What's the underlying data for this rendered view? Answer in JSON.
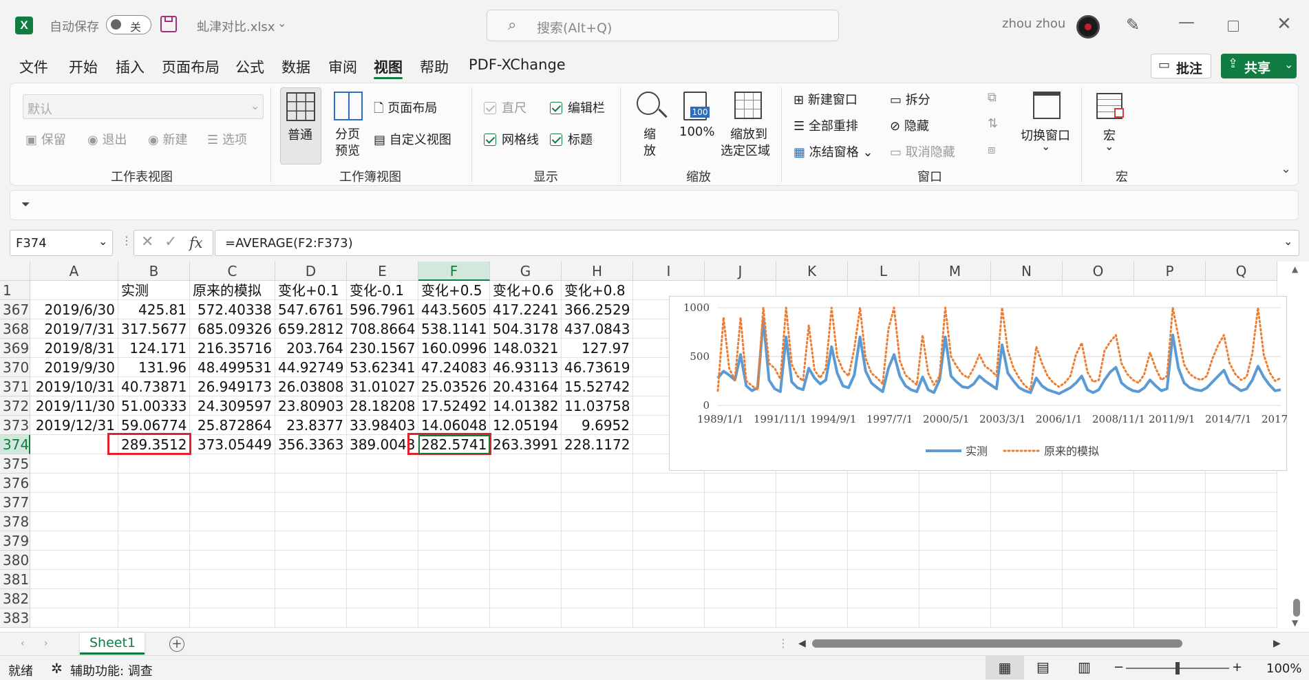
{
  "titlebar": {
    "autosave_label": "自动保存",
    "autosave_state": "关",
    "filename": "虬津对比.xlsx",
    "search_placeholder": "搜索(Alt+Q)",
    "user_name": "zhou zhou"
  },
  "menu": {
    "items": [
      "文件",
      "开始",
      "插入",
      "页面布局",
      "公式",
      "数据",
      "审阅",
      "视图",
      "帮助",
      "PDF-XChange"
    ],
    "active": "视图",
    "comments_btn": "批注",
    "share_btn": "共享"
  },
  "ribbon": {
    "sheet_view": {
      "select_value": "默认",
      "keep": "保留",
      "exit": "退出",
      "new": "新建",
      "options": "选项",
      "label": "工作表视图"
    },
    "workbook_view": {
      "normal": "普通",
      "page_break_1": "分页",
      "page_break_2": "预览",
      "page_layout": "页面布局",
      "custom_view": "自定义视图",
      "label": "工作簿视图"
    },
    "show": {
      "ruler": "直尺",
      "formula_bar": "编辑栏",
      "gridlines": "网格线",
      "headings": "标题",
      "label": "显示"
    },
    "zoom": {
      "zoom_1": "缩",
      "zoom_2": "放",
      "zoom_100": "100%",
      "zoom_sel_1": "缩放到",
      "zoom_sel_2": "选定区域",
      "label": "缩放",
      "icon_text": "100"
    },
    "window": {
      "new_window": "新建窗口",
      "arrange_all": "全部重排",
      "freeze": "冻结窗格",
      "split": "拆分",
      "hide": "隐藏",
      "unhide": "取消隐藏",
      "switch": "切换窗口",
      "label": "窗口"
    },
    "macros": {
      "macro": "宏",
      "label": "宏"
    }
  },
  "formula_bar": {
    "name_box": "F374",
    "formula": "=AVERAGE(F2:F373)",
    "fx": "fx"
  },
  "grid": {
    "columns": [
      "A",
      "B",
      "C",
      "D",
      "E",
      "F",
      "G",
      "H",
      "I",
      "J",
      "K",
      "L",
      "M",
      "N",
      "O",
      "P",
      "Q"
    ],
    "header_row": {
      "num": "1",
      "cells": [
        "",
        "实测",
        "原来的模拟",
        "变化+0.1",
        "变化-0.1",
        "变化+0.5",
        "变化+0.6",
        "变化+0.8"
      ]
    },
    "rows": [
      {
        "num": "367",
        "cells": [
          "2019/6/30",
          "425.81",
          "572.40338",
          "547.6761",
          "596.7961",
          "443.5605",
          "417.2241",
          "366.2529"
        ]
      },
      {
        "num": "368",
        "cells": [
          "2019/7/31",
          "317.5677",
          "685.09326",
          "659.2812",
          "708.8664",
          "538.1141",
          "504.3178",
          "437.0843"
        ]
      },
      {
        "num": "369",
        "cells": [
          "2019/8/31",
          "124.171",
          "216.35716",
          "203.764",
          "230.1567",
          "160.0996",
          "148.0321",
          "127.97"
        ]
      },
      {
        "num": "370",
        "cells": [
          "2019/9/30",
          "131.96",
          "48.499531",
          "44.92749",
          "53.62341",
          "47.24083",
          "46.93113",
          "46.73619"
        ]
      },
      {
        "num": "371",
        "cells": [
          "2019/10/31",
          "40.73871",
          "26.949173",
          "26.03808",
          "31.01027",
          "25.03526",
          "20.43164",
          "15.52742"
        ]
      },
      {
        "num": "372",
        "cells": [
          "2019/11/30",
          "51.00333",
          "24.309597",
          "23.80903",
          "28.18208",
          "17.52492",
          "14.01382",
          "11.03758"
        ]
      },
      {
        "num": "373",
        "cells": [
          "2019/12/31",
          "59.06774",
          "25.872864",
          "23.8377",
          "33.98403",
          "14.06048",
          "12.05194",
          "9.6952"
        ]
      },
      {
        "num": "374",
        "cells": [
          "",
          "289.3512",
          "373.05449",
          "356.3363",
          "389.0043",
          "282.5741",
          "263.3991",
          "228.1172"
        ]
      },
      {
        "num": "375",
        "cells": [
          "",
          "",
          "",
          "",
          "",
          "",
          "",
          ""
        ]
      },
      {
        "num": "376",
        "cells": [
          "",
          "",
          "",
          "",
          "",
          "",
          "",
          ""
        ]
      },
      {
        "num": "377",
        "cells": [
          "",
          "",
          "",
          "",
          "",
          "",
          "",
          ""
        ]
      },
      {
        "num": "378",
        "cells": [
          "",
          "",
          "",
          "",
          "",
          "",
          "",
          ""
        ]
      },
      {
        "num": "379",
        "cells": [
          "",
          "",
          "",
          "",
          "",
          "",
          "",
          ""
        ]
      },
      {
        "num": "380",
        "cells": [
          "",
          "",
          "",
          "",
          "",
          "",
          "",
          ""
        ]
      },
      {
        "num": "381",
        "cells": [
          "",
          "",
          "",
          "",
          "",
          "",
          "",
          ""
        ]
      },
      {
        "num": "382",
        "cells": [
          "",
          "",
          "",
          "",
          "",
          "",
          "",
          ""
        ]
      },
      {
        "num": "383",
        "cells": [
          "",
          "",
          "",
          "",
          "",
          "",
          "",
          ""
        ]
      }
    ]
  },
  "chart_data": {
    "type": "line",
    "title": "",
    "y_ticks": [
      "1000",
      "500",
      "0"
    ],
    "ylim": [
      0,
      1000
    ],
    "x_ticks": [
      "1989/1/1",
      "1991/11/1",
      "1994/9/1",
      "1997/7/1",
      "2000/5/1",
      "2003/3/1",
      "2006/1/1",
      "2008/11/1",
      "2011/9/1",
      "2014/7/1",
      "2017"
    ],
    "series": [
      {
        "name": "实测",
        "style": "solid",
        "color": "#5b9bd5",
        "values": [
          280,
          350,
          310,
          260,
          520,
          200,
          150,
          180,
          880,
          260,
          170,
          140,
          700,
          240,
          180,
          160,
          380,
          280,
          220,
          260,
          600,
          330,
          200,
          180,
          310,
          700,
          350,
          230,
          180,
          140,
          380,
          520,
          300,
          200,
          160,
          140,
          290,
          160,
          130,
          260,
          700,
          300,
          240,
          190,
          180,
          220,
          300,
          250,
          210,
          170,
          620,
          330,
          250,
          180,
          150,
          130,
          280,
          200,
          160,
          140,
          120,
          150,
          180,
          230,
          300,
          160,
          130,
          160,
          260,
          340,
          390,
          230,
          180,
          150,
          140,
          180,
          260,
          200,
          150,
          170,
          720,
          380,
          230,
          180,
          160,
          150,
          180,
          240,
          300,
          360,
          230,
          190,
          150,
          170,
          260,
          400,
          290,
          210,
          150,
          160
        ]
      },
      {
        "name": "原来的模拟",
        "style": "dotted",
        "color": "#ed7d31",
        "values": [
          150,
          900,
          380,
          260,
          900,
          250,
          200,
          160,
          1000,
          430,
          380,
          270,
          1000,
          420,
          300,
          250,
          820,
          360,
          280,
          380,
          1000,
          500,
          360,
          300,
          580,
          1000,
          480,
          330,
          280,
          220,
          780,
          1000,
          460,
          310,
          260,
          210,
          720,
          330,
          210,
          300,
          1000,
          500,
          400,
          320,
          280,
          380,
          520,
          400,
          360,
          300,
          1000,
          560,
          380,
          280,
          200,
          160,
          600,
          430,
          300,
          230,
          190,
          230,
          300,
          520,
          640,
          340,
          240,
          260,
          560,
          650,
          720,
          430,
          320,
          260,
          230,
          320,
          540,
          380,
          260,
          300,
          1000,
          700,
          420,
          320,
          280,
          260,
          300,
          480,
          620,
          720,
          430,
          320,
          260,
          290,
          530,
          1000,
          520,
          340,
          250,
          280
        ]
      }
    ],
    "legend_position": "bottom"
  },
  "tabs": {
    "sheet1": "Sheet1",
    "add": "+"
  },
  "status": {
    "ready": "就绪",
    "accessibility": "辅助功能: 调查",
    "zoom": "100%",
    "minus": "−",
    "plus": "+"
  }
}
